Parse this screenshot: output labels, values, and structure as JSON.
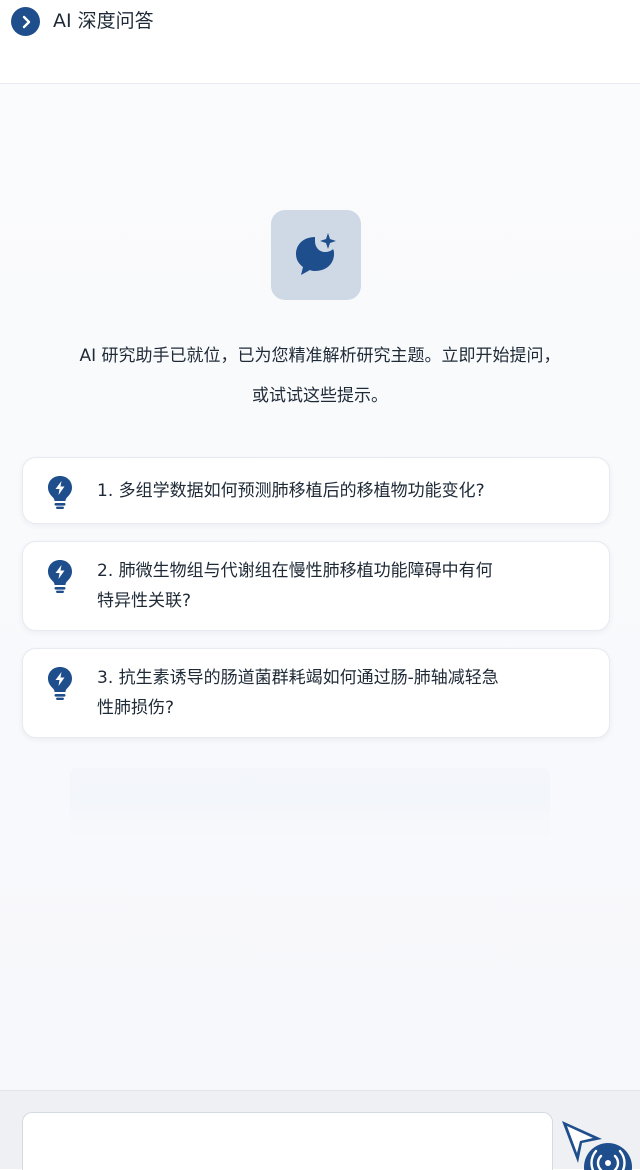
{
  "header": {
    "title": "AI 深度问答",
    "back_icon": "chevron-right-icon"
  },
  "colors": {
    "accent": "#1f4e8c",
    "logo_tile_bg": "#cfd9e6",
    "page_bg": "#f7f8fb"
  },
  "assistant": {
    "logo_icon": "chat-sparkle-icon",
    "intro_line1": "AI 研究助手已就位，已为您精准解析研究主题。立即开始提问，",
    "intro_line2": "或试试这些提示。"
  },
  "suggestions": [
    {
      "icon": "lightbulb-bolt-icon",
      "line1": "1. 多组学数据如何预测肺移植后的移植物功能变化?",
      "line2": ""
    },
    {
      "icon": "lightbulb-bolt-icon",
      "line1": "2. 肺微生物组与代谢组在慢性肺移植功能障碍中有何",
      "line2": "特异性关联?"
    },
    {
      "icon": "lightbulb-bolt-icon",
      "line1": "3. 抗生素诱导的肠道菌群耗竭如何通过肠-肺轴减轻急",
      "line2": "性肺损伤?"
    }
  ],
  "composer": {
    "input_value": "",
    "send_icon": "send-icon",
    "voice_icon": "broadcast-icon"
  }
}
